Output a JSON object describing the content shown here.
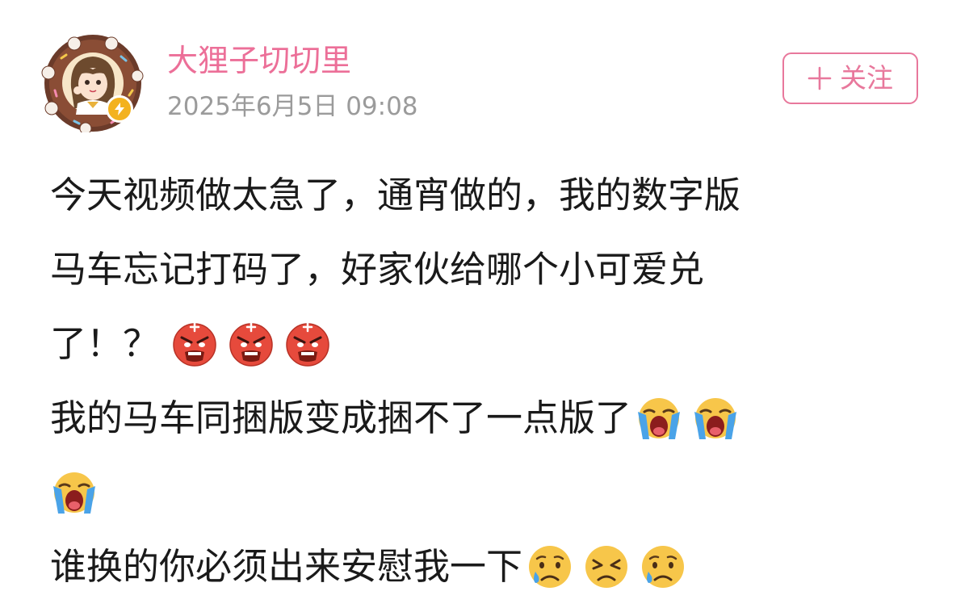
{
  "post": {
    "author": {
      "name": "大狸子切切里",
      "timestamp": "2025年6月5日 09:08",
      "avatar_icon": "avatar-donut-girl",
      "verified_icon": "lightning-verified-badge"
    },
    "follow_button": {
      "icon": "plus-icon",
      "label": "关注"
    },
    "lines": [
      "今天视频做太急了，通宵做的，我的数字版",
      "马车忘记打码了，好家伙给哪个小可爱兑",
      "了！？",
      "我的马车同捆版变成捆不了一点版了",
      "",
      "谁换的你必须出来安慰我一下"
    ],
    "emojis": {
      "line3": [
        "angry-face-emoji",
        "angry-face-emoji",
        "angry-face-emoji"
      ],
      "line4": [
        "loudly-crying-emoji",
        "loudly-crying-emoji"
      ],
      "line5": [
        "loudly-crying-emoji"
      ],
      "line6": [
        "crying-face-emoji",
        "tired-face-emoji",
        "crying-face-emoji"
      ]
    }
  },
  "colors": {
    "username": "#ec6f98",
    "timestamp": "#9b9b9b",
    "follow_accent": "#e8789c",
    "body_text": "#1a1a1a",
    "verified_badge": "#f3b21f"
  }
}
